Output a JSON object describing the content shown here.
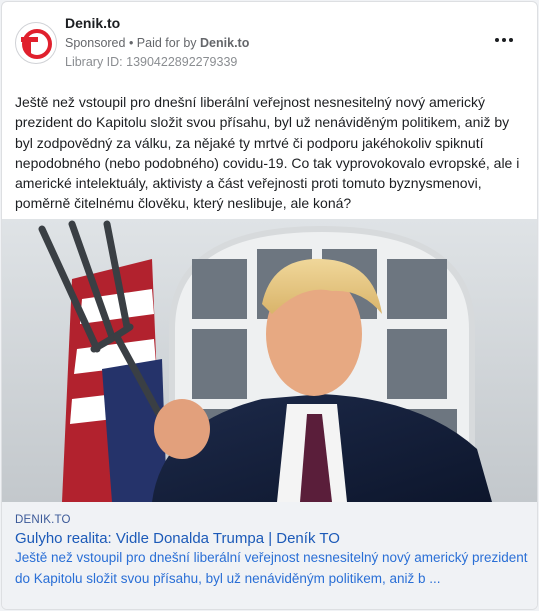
{
  "ad": {
    "page_name": "Denik.to",
    "sponsored": "Sponsored",
    "paid_for_prefix": " • Paid for by ",
    "paid_for_by": "Denik.to",
    "library_id": "Library ID: 1390422892279339",
    "body": "Ještě než vstoupil pro dnešní liberální veřejnost nesnesitelný nový americký prezident do Kapitolu složit svou přísahu, byl už nenáviděným politikem, aniž by byl zodpovědný za válku, za nějaké ty mrtvé či podporu jakéhokoliv spiknutí nepodobného (nebo podobného) covidu-19. Co tak vyprovokovalo evropské, ale i americké intelektuály, aktivisty a část veřejnosti proti tomuto byznysmenovi, poměrně čitelnému člověku, který neslibuje, ale koná?",
    "logo_text": "TO"
  },
  "link_preview": {
    "domain": "DENIK.TO",
    "headline": "Gulyho realita: Vidle Donalda Trumpa | Deník TO",
    "description": "Ještě než vstoupil pro dnešní liberální veřejnost nesnesitelný nový americký prezident do Kapitolu složit svou přísahu, byl už nenáviděným politikem, aniž b ..."
  },
  "icons": {
    "more": "more-horizontal-icon",
    "logo": "denik-to-logo"
  },
  "colors": {
    "brand_red": "#e0202d",
    "link_blue": "#1c5ab8"
  }
}
